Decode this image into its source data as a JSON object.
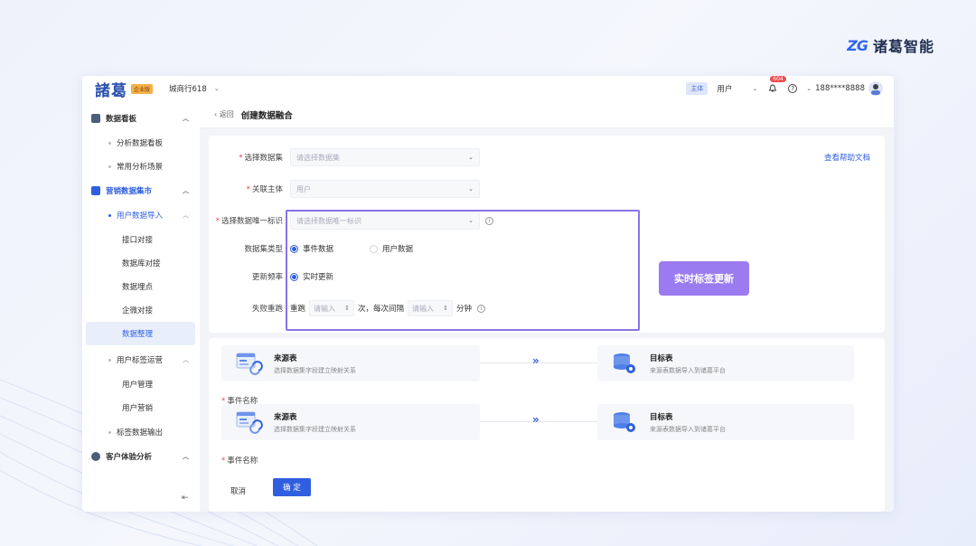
{
  "brand": {
    "mark": "ZG",
    "name": "诸葛智能"
  },
  "app": {
    "logo": "諸葛",
    "edition": "企业版",
    "store": "城商行618"
  },
  "topbar": {
    "subject_tag": "主体",
    "subject_value": "用户",
    "notification_count": "604",
    "help": "?",
    "phone": "188****8888"
  },
  "sidebar": {
    "items": [
      {
        "label": "数据看板",
        "level": "group"
      },
      {
        "label": "分析数据看板",
        "level": "sub"
      },
      {
        "label": "常用分析场景",
        "level": "sub"
      },
      {
        "label": "营销数据集市",
        "level": "group"
      },
      {
        "label": "用户数据导入",
        "level": "sub"
      },
      {
        "label": "接口对接",
        "level": "leaf"
      },
      {
        "label": "数据库对接",
        "level": "leaf"
      },
      {
        "label": "数据埋点",
        "level": "leaf"
      },
      {
        "label": "企微对接",
        "level": "leaf"
      },
      {
        "label": "数据整理",
        "level": "leaf"
      },
      {
        "label": "用户标签运营",
        "level": "sub"
      },
      {
        "label": "用户管理",
        "level": "leaf"
      },
      {
        "label": "用户营销",
        "level": "leaf"
      },
      {
        "label": "标签数据输出",
        "level": "sub"
      },
      {
        "label": "客户体验分析",
        "level": "group"
      }
    ],
    "collapse_icon": "collapse-icon"
  },
  "header": {
    "back": "返回",
    "title": "创建数据融合"
  },
  "form": {
    "help_link": "查看帮助文档",
    "dataset_label": "选择数据集",
    "dataset_placeholder": "请选择数据集",
    "subject_label": "关联主体",
    "subject_placeholder": "用户",
    "unique_id_label": "选择数据唯一标识",
    "unique_id_placeholder": "请选择数据唯一标识",
    "type_label": "数据集类型",
    "type_options": [
      "事件数据",
      "用户数据"
    ],
    "freq_label": "更新频率",
    "freq_option": "实时更新",
    "retry_label": "失败重跑",
    "retry_prefix": "重跑",
    "retry_input_placeholder": "请输入",
    "retry_times_suffix": "次，每次间隔",
    "retry_interval_placeholder": "请输入",
    "retry_interval_suffix": "分钟"
  },
  "callout": {
    "text": "实时标签更新"
  },
  "mapping": {
    "rows": [
      {
        "source_title": "来源表",
        "source_desc": "选择数据集字段建立映射关系",
        "target_title": "目标表",
        "target_desc": "来源表数据导入到诸葛平台",
        "event_label": "事件名称"
      },
      {
        "source_title": "来源表",
        "source_desc": "选择数据集字段建立映射关系",
        "target_title": "目标表",
        "target_desc": "来源表数据导入到诸葛平台",
        "event_label": "事件名称"
      }
    ]
  },
  "actions": {
    "cancel": "取消",
    "ok": "确 定"
  },
  "colors": {
    "accent": "#2f5fe0",
    "highlight": "#8b73e6",
    "callout": "#9b7cf0"
  }
}
